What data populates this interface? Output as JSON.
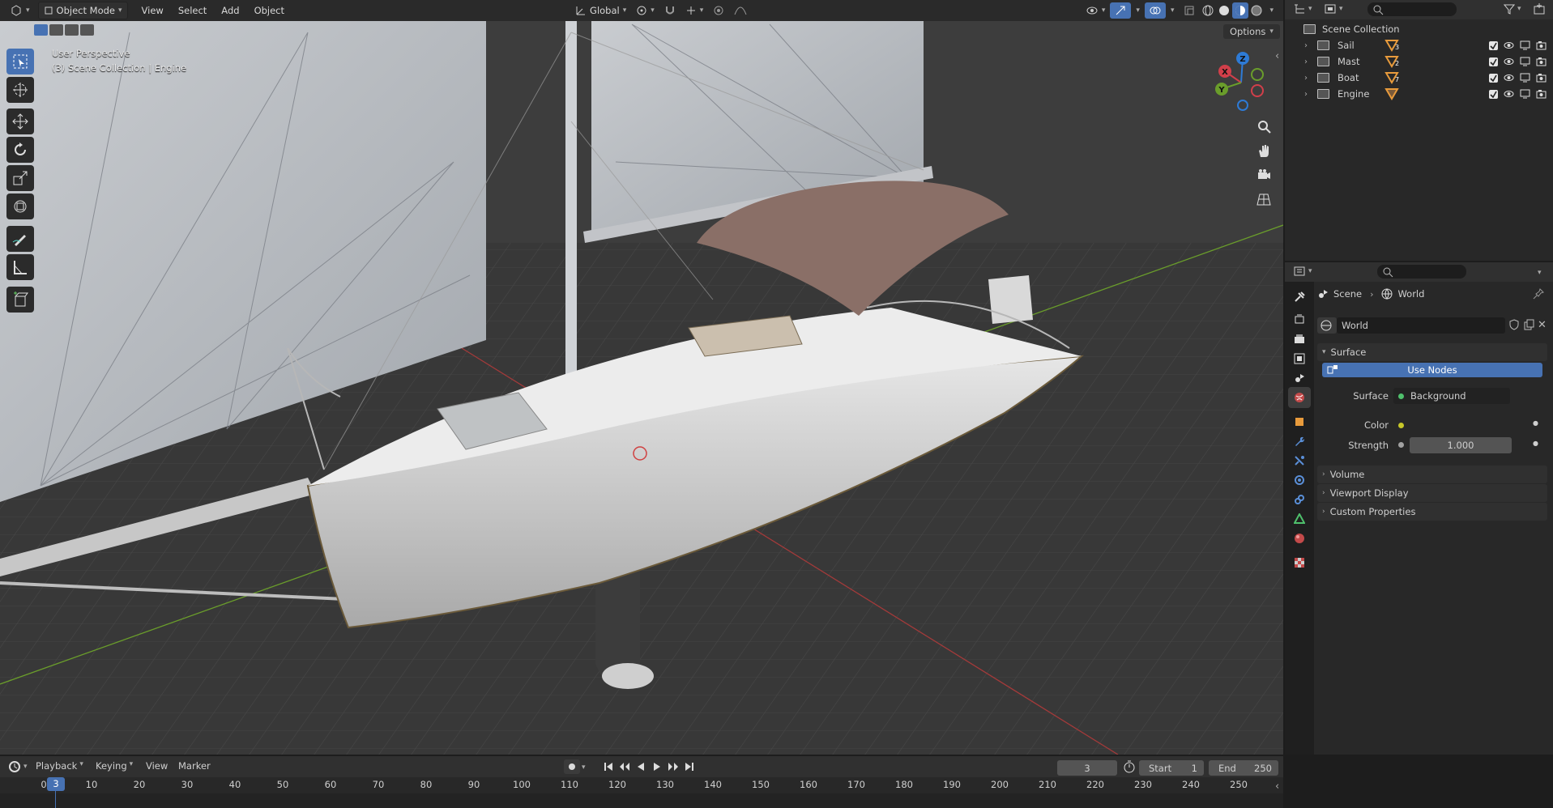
{
  "viewport": {
    "mode_label": "Object Mode",
    "menus": [
      "View",
      "Select",
      "Add",
      "Object"
    ],
    "transform_orientation": "Global",
    "options_label": "Options",
    "overlay_title": "User Perspective",
    "overlay_subtitle": "(3) Scene Collection | Engine",
    "gizmo_axes": {
      "x": "X",
      "y": "Y",
      "z": "Z"
    },
    "colors": {
      "x_axis": "#d13f4a",
      "y_axis": "#6a9d2b",
      "z_axis": "#2e7bd6",
      "accent": "#4772b3"
    }
  },
  "tools": [
    "select-box-icon",
    "cursor-icon",
    "move-icon",
    "rotate-icon",
    "scale-icon",
    "transform-icon",
    "annotate-icon",
    "measure-icon",
    "add-cube-icon"
  ],
  "outliner": {
    "root": "Scene Collection",
    "items": [
      {
        "name": "Sail",
        "badge": "3"
      },
      {
        "name": "Mast",
        "badge": "2"
      },
      {
        "name": "Boat",
        "badge": "7"
      },
      {
        "name": "Engine",
        "badge": ""
      }
    ]
  },
  "properties": {
    "breadcrumb": {
      "scene": "Scene",
      "world": "World"
    },
    "world_name": "World",
    "surface_panel": "Surface",
    "use_nodes_label": "Use Nodes",
    "surface_label": "Surface",
    "surface_value": "Background",
    "color_label": "Color",
    "strength_label": "Strength",
    "strength_value": "1.000",
    "panels": [
      "Volume",
      "Viewport Display",
      "Custom Properties"
    ]
  },
  "timeline": {
    "menus": [
      "Playback",
      "Keying",
      "View",
      "Marker"
    ],
    "current_frame": "3",
    "start_label": "Start",
    "start_value": "1",
    "end_label": "End",
    "end_value": "250",
    "playhead_label": "3",
    "ticks": [
      "0",
      "10",
      "20",
      "30",
      "40",
      "50",
      "60",
      "70",
      "80",
      "90",
      "100",
      "110",
      "120",
      "130",
      "140",
      "150",
      "160",
      "170",
      "180",
      "190",
      "200",
      "210",
      "220",
      "230",
      "240",
      "250"
    ]
  }
}
